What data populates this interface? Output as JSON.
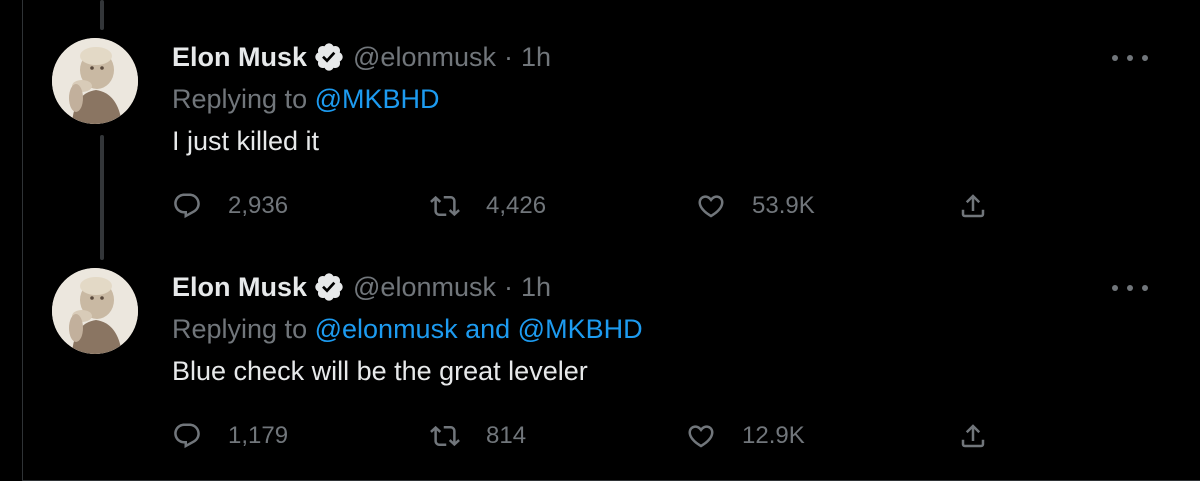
{
  "tweets": [
    {
      "display_name": "Elon Musk",
      "handle": "@elonmusk",
      "separator": "·",
      "time": "1h",
      "replying_prefix": "Replying to",
      "mention_1": "@MKBHD",
      "text": "I just killed it",
      "replies": "2,936",
      "retweets": "4,426",
      "likes": "53.9K"
    },
    {
      "display_name": "Elon Musk",
      "handle": "@elonmusk",
      "separator": "·",
      "time": "1h",
      "replying_prefix": "Replying to",
      "mention_1": "@elonmusk",
      "conjunction": "and",
      "mention_2": "@MKBHD",
      "text": "Blue check will be the great leveler",
      "replies": "1,179",
      "retweets": "814",
      "likes": "12.9K"
    }
  ],
  "icons": {
    "verified": "verified-badge-icon",
    "reply": "reply-icon",
    "retweet": "retweet-icon",
    "like": "heart-icon",
    "share": "share-icon",
    "more": "more-icon"
  },
  "colors": {
    "background": "#000000",
    "text": "#e7e9ea",
    "secondary": "#71767b",
    "accent": "#1d9bf0"
  }
}
